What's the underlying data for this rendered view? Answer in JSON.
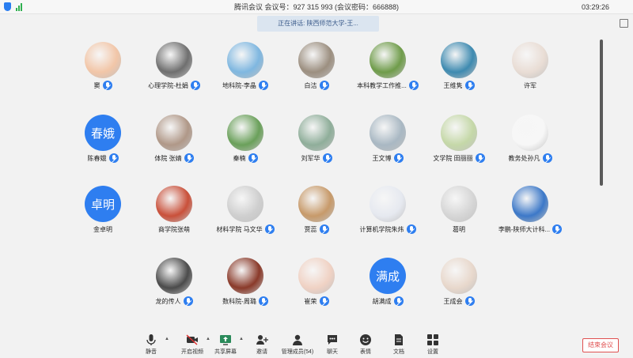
{
  "title_bar": {
    "title": "腾讯会议  会议号：927 315 993  (会议密码：666888)",
    "clock": "03:29:26"
  },
  "speaking_banner": "正在讲话: 陕西师范大学-王...",
  "participants": [
    {
      "name": "窦",
      "avatar_text": "",
      "color": "#f2c6a8",
      "mic": true
    },
    {
      "name": "心理学院-杜娟",
      "avatar_text": "",
      "color": "#6f6f6f",
      "mic": true
    },
    {
      "name": "地科院-李晶",
      "avatar_text": "",
      "color": "#7fb7e0",
      "mic": true
    },
    {
      "name": "白洁",
      "avatar_text": "",
      "color": "#9c8f80",
      "mic": true
    },
    {
      "name": "本科教学工作推...",
      "avatar_text": "",
      "color": "#6f9c4a",
      "mic": true
    },
    {
      "name": "王维隽",
      "avatar_text": "",
      "color": "#3e8ab0",
      "mic": true
    },
    {
      "name": "许军",
      "avatar_text": "",
      "color": "#e9ddd5",
      "mic": false
    },
    {
      "name": "陈春娥",
      "avatar_text": "春娥",
      "color": "#2e7ef0",
      "mic": true
    },
    {
      "name": "体院 张婧",
      "avatar_text": "",
      "color": "#b09888",
      "mic": true
    },
    {
      "name": "秦楠",
      "avatar_text": "",
      "color": "#6aa05a",
      "mic": true
    },
    {
      "name": "刘军华",
      "avatar_text": "",
      "color": "#8fae9a",
      "mic": true
    },
    {
      "name": "王文博",
      "avatar_text": "",
      "color": "#a9b8c3",
      "mic": true
    },
    {
      "name": "文学院 田丽丽",
      "avatar_text": "",
      "color": "#c5d8a8",
      "mic": true
    },
    {
      "name": "教务处孙凡",
      "avatar_text": "",
      "color": "#f7f7f7",
      "mic": true
    },
    {
      "name": "金卓明",
      "avatar_text": "卓明",
      "color": "#2e7ef0",
      "mic": false
    },
    {
      "name": "商学院张萌",
      "avatar_text": "",
      "color": "#c9503a",
      "mic": false
    },
    {
      "name": "材料学院 马文华",
      "avatar_text": "",
      "color": "#cfcfcf",
      "mic": true
    },
    {
      "name": "贾蕊",
      "avatar_text": "",
      "color": "#c79a6a",
      "mic": true
    },
    {
      "name": "计算机学院朱炜",
      "avatar_text": "",
      "color": "#e6e9f0",
      "mic": true
    },
    {
      "name": "葛明",
      "avatar_text": "",
      "color": "#d6d6d6",
      "mic": false
    },
    {
      "name": "李鹏-陕师大计科...",
      "avatar_text": "",
      "color": "#3c78c8",
      "mic": true
    },
    {
      "name": "龙的传人",
      "avatar_text": "",
      "color": "#4b4b4b",
      "mic": true
    },
    {
      "name": "数科院-周璐",
      "avatar_text": "",
      "color": "#8a3a2a",
      "mic": true
    },
    {
      "name": "崔荣",
      "avatar_text": "",
      "color": "#f0d2c4",
      "mic": true
    },
    {
      "name": "胡满成",
      "avatar_text": "满成",
      "color": "#2e7ef0",
      "mic": true
    },
    {
      "name": "王成会",
      "avatar_text": "",
      "color": "#e8d8cc",
      "mic": true
    }
  ],
  "toolbar": {
    "mute": "静音",
    "video": "开启视频",
    "share": "共享屏幕",
    "invite": "邀请",
    "members": "管理成员(54)",
    "chat": "聊天",
    "reactions": "表情",
    "docs": "文档",
    "settings": "设置",
    "end": "结束会议"
  }
}
